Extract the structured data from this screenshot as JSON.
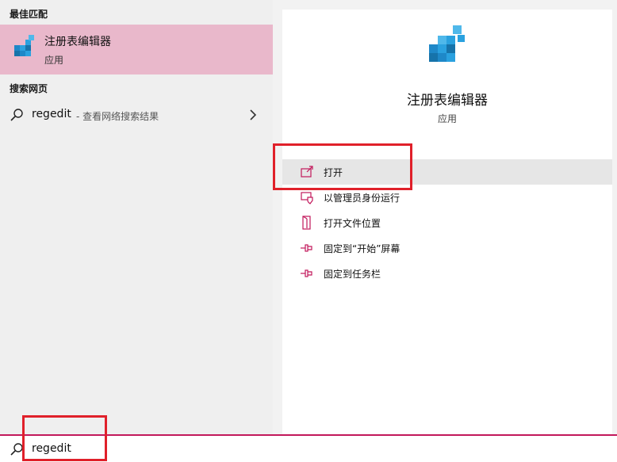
{
  "left_pane": {
    "best_match_header": "最佳匹配",
    "best_match": {
      "title": "注册表编辑器",
      "subtitle": "应用",
      "icon": "registry-editor-icon"
    },
    "web_header": "搜索网页",
    "web_result": {
      "query": "regedit",
      "hint": "- 查看网络搜索结果"
    }
  },
  "detail": {
    "title": "注册表编辑器",
    "subtitle": "应用",
    "actions": [
      {
        "label": "打开",
        "icon": "open-icon"
      },
      {
        "label": "以管理员身份运行",
        "icon": "run-as-admin-icon"
      },
      {
        "label": "打开文件位置",
        "icon": "file-location-icon"
      },
      {
        "label": "固定到“开始”屏幕",
        "icon": "pin-icon"
      },
      {
        "label": "固定到任务栏",
        "icon": "pin-icon"
      }
    ]
  },
  "search": {
    "value": "regedit"
  },
  "colors": {
    "selection": "#e9b8cb",
    "accent": "#c2185b",
    "annotation": "#e0202a"
  }
}
